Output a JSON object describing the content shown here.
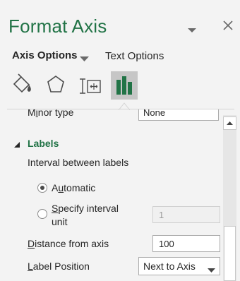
{
  "pane": {
    "title": "Format Axis"
  },
  "tabs": {
    "axis_options": "Axis Options",
    "text_options": "Text Options"
  },
  "icon_tabs": [
    "fill-line-icon",
    "effects-icon",
    "size-properties-icon",
    "axis-options-icon"
  ],
  "minor_type": {
    "label_prefix": "M",
    "label_u": "i",
    "label_rest": "nor type",
    "value": "None"
  },
  "labels_section": {
    "title": "Labels",
    "interval_label": "Interval between labels",
    "automatic_pre": "A",
    "automatic_u": "u",
    "automatic_post": "tomatic",
    "automatic_selected": true,
    "specify_u": "S",
    "specify_post": "pecify interval",
    "specify_line2": "unit",
    "specify_value": "1",
    "distance_u": "D",
    "distance_post": "istance from axis",
    "distance_value": "100",
    "position_u": "L",
    "position_post": "abel Position",
    "position_value": "Next to Axis"
  },
  "colors": {
    "accent": "#217346",
    "background": "#f3f3f3"
  }
}
